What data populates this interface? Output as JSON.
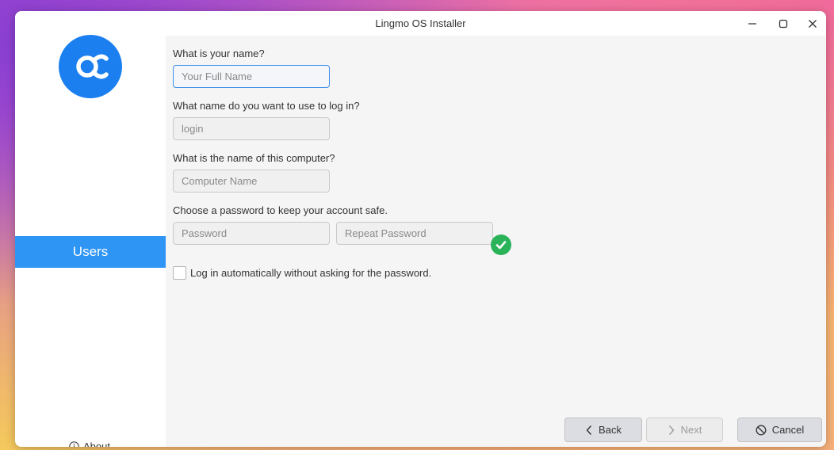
{
  "window": {
    "title": "Lingmo OS Installer",
    "controls": [
      "minimize-icon",
      "maximize-icon",
      "close-icon"
    ]
  },
  "sidebar": {
    "logo": "lingmo-logo",
    "active_step": "Users",
    "about_label": "About",
    "accent": "#2e95f5"
  },
  "form": {
    "name_label": "What is your name?",
    "name_placeholder": "Your Full Name",
    "login_label": "What name do you want to use to log in?",
    "login_placeholder": "login",
    "computer_label": "What is the name of this computer?",
    "computer_placeholder": "Computer Name",
    "password_label": "Choose a password to keep your account safe.",
    "password_placeholder": "Password",
    "repeat_placeholder": "Repeat Password",
    "password_status": "check-icon",
    "autologin_label": "Log in automatically without asking for the password.",
    "autologin_checked": false
  },
  "buttons": {
    "back": "Back",
    "next": "Next",
    "cancel": "Cancel"
  },
  "colors": {
    "logo": "#1b7ff0",
    "ok": "#2bb35a",
    "focus": "#3d8ee8"
  }
}
